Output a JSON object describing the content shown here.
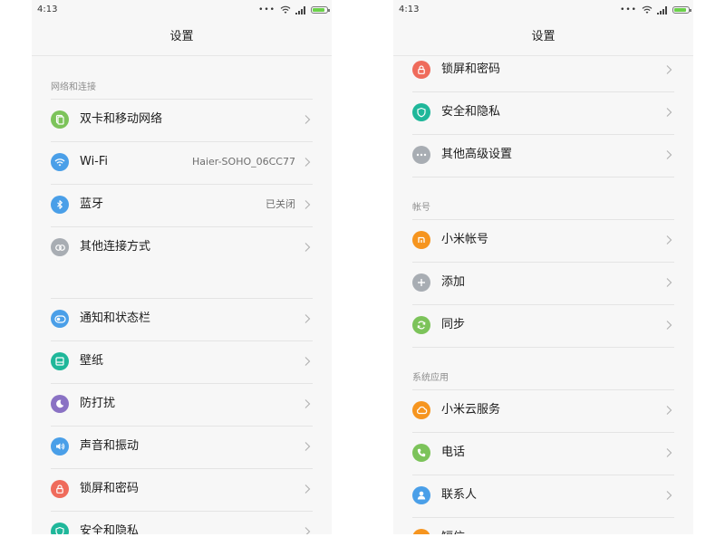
{
  "left": {
    "status": {
      "time": "4:13"
    },
    "title": "设置",
    "section_network": "网络和连接",
    "items": [
      {
        "label": "双卡和移动网络",
        "value": ""
      },
      {
        "label": "Wi-Fi",
        "value": "Haier-SOHO_06CC77"
      },
      {
        "label": "蓝牙",
        "value": "已关闭"
      },
      {
        "label": "其他连接方式",
        "value": ""
      },
      {
        "label": "通知和状态栏",
        "value": ""
      },
      {
        "label": "壁纸",
        "value": ""
      },
      {
        "label": "防打扰",
        "value": ""
      },
      {
        "label": "声音和振动",
        "value": ""
      },
      {
        "label": "锁屏和密码",
        "value": ""
      },
      {
        "label": "安全和隐私",
        "value": ""
      }
    ]
  },
  "right": {
    "status": {
      "time": "4:13"
    },
    "title": "设置",
    "section_account": "帐号",
    "section_apps": "系统应用",
    "items": [
      {
        "label": "锁屏和密码"
      },
      {
        "label": "安全和隐私"
      },
      {
        "label": "其他高级设置"
      },
      {
        "label": "小米帐号"
      },
      {
        "label": "添加"
      },
      {
        "label": "同步"
      },
      {
        "label": "小米云服务"
      },
      {
        "label": "电话"
      },
      {
        "label": "联系人"
      },
      {
        "label": "短信"
      }
    ]
  },
  "colors": {
    "green": "#7cc35a",
    "blue": "#4a9fe8",
    "gray": "#a8adb3",
    "teal": "#1fb79a",
    "purple": "#8a72c4",
    "red": "#ef6b5b",
    "orange": "#f6951f"
  },
  "icons": {
    "dual_sim": "sim-card-icon",
    "wifi": "wifi-icon",
    "bluetooth": "bluetooth-icon",
    "other_connection": "link-icon",
    "notification": "toggle-icon",
    "wallpaper": "wallpaper-icon",
    "dnd": "moon-icon",
    "sound": "speaker-icon",
    "lock": "lock-icon",
    "security": "shield-icon",
    "advanced": "more-dots-icon",
    "mi_account": "mi-logo-icon",
    "add": "plus-icon",
    "sync": "sync-icon",
    "cloud": "cloud-icon",
    "phone": "phone-icon",
    "contacts": "person-icon",
    "sms": "message-icon"
  }
}
